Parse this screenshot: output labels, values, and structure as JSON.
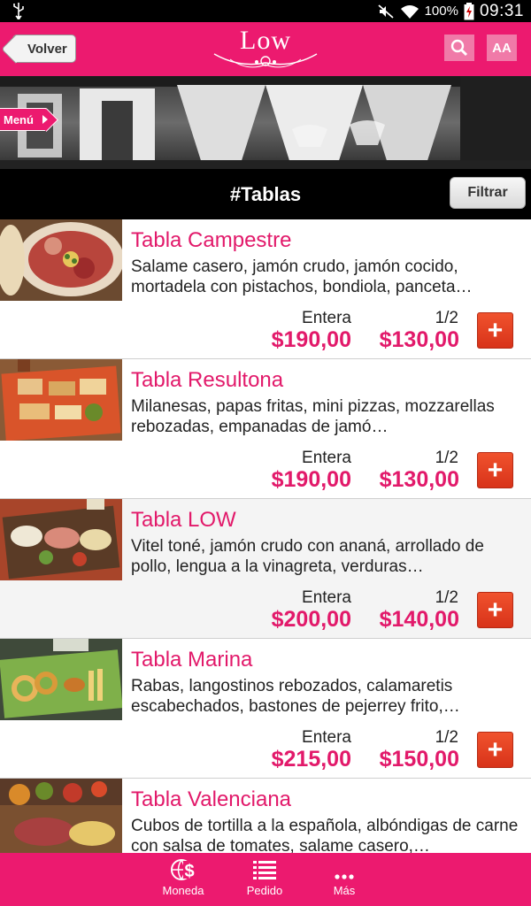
{
  "status_bar": {
    "battery_pct": "100%",
    "time": "09:31"
  },
  "header": {
    "back_label": "Volver",
    "logo_text": "Low",
    "font_button_label": "AA"
  },
  "banner": {
    "menu_tab_label": "Menú"
  },
  "section": {
    "title": "#Tablas",
    "filter_label": "Filtrar"
  },
  "price_labels": {
    "whole": "Entera",
    "half": "1/2"
  },
  "items": [
    {
      "name": "Tabla Campestre",
      "desc": "Salame casero, jamón crudo, jamón cocido, mortadela con pistachos, bondiola, panceta…",
      "price_whole": "$190,00",
      "price_half": "$130,00"
    },
    {
      "name": "Tabla Resultona",
      "desc": "Milanesas, papas fritas, mini pizzas, mozzarellas rebozadas, empanadas de jamó…",
      "price_whole": "$190,00",
      "price_half": "$130,00"
    },
    {
      "name": "Tabla LOW",
      "desc": "Vitel toné, jamón crudo con ananá, arrollado de pollo, lengua a la vinagreta, verduras…",
      "price_whole": "$200,00",
      "price_half": "$140,00"
    },
    {
      "name": "Tabla Marina",
      "desc": "Rabas, langostinos rebozados, calamaretis escabechados, bastones de pejerrey frito,…",
      "price_whole": "$215,00",
      "price_half": "$150,00"
    },
    {
      "name": "Tabla Valenciana",
      "desc": "Cubos de tortilla a la española, albóndigas de carne con salsa de tomates, salame casero,…",
      "price_whole": "",
      "price_half": ""
    }
  ],
  "bottom_nav": {
    "moneda": "Moneda",
    "pedido": "Pedido",
    "mas": "Más"
  },
  "colors": {
    "brand_pink": "#ec1a6f",
    "price_pink": "#e2196a",
    "add_red": "#e0401f"
  }
}
